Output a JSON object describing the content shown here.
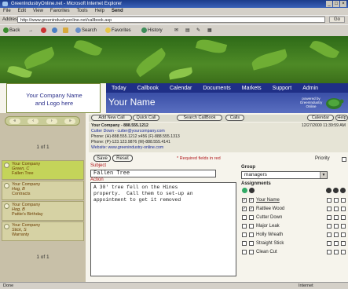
{
  "window": {
    "title": "GreenIndustryOnline.net - Microsoft Internet Explorer"
  },
  "menu": [
    "File",
    "Edit",
    "View",
    "Favorites",
    "Tools",
    "Help",
    "Send"
  ],
  "address": {
    "label": "Address",
    "url": "http://www.greenindustryonline.net/callbook.asp",
    "go": "Go"
  },
  "toolbar": {
    "back": "Back",
    "search": "Search",
    "favorites": "Favorites",
    "history": "History"
  },
  "site": {
    "logo_line1": "Your Company Name",
    "logo_line2": "and Logo here",
    "nav": [
      "Today",
      "Callbook",
      "Calendar",
      "Documents",
      "Markets",
      "Support",
      "Admin"
    ],
    "company_name": "Your Name",
    "powered_by": "powered by GreenIndustry Online"
  },
  "sidebar": {
    "page_top": "1 of 1",
    "page_bottom": "1 of 1",
    "contacts": [
      {
        "line1": "Your Company",
        "line2": "Green, C",
        "line3": "Fallen Tree",
        "selected": true
      },
      {
        "line1": "Your Company",
        "line2": "Hog, B",
        "line3": "Contracts",
        "selected": false
      },
      {
        "line1": "Your Company",
        "line2": "Hog, B",
        "line3": "Pattie's Birthday",
        "selected": false
      },
      {
        "line1": "Your Company",
        "line2": "Stick, S",
        "line3": "Warranty",
        "selected": false
      }
    ]
  },
  "actions": {
    "add_new_call": "Add New Call",
    "quick_call": "Quick Call",
    "search_callbook": "Search CallBook",
    "calls": "Calls",
    "calendar": "Calendar",
    "help": "Help"
  },
  "contact_info": {
    "company_line": "Your Company - 888.555.1212",
    "person_line": "Cutter Down - cutter@yourcompany.com",
    "phone1": "Phone: (H)-888.555.1212 x456  (F)-888.555.1313",
    "phone2": "Phone: (P)-123.123.9876  (M)-888.555.4141",
    "website": "Website: www.greenindustry-online.com",
    "timestamp": "12/27/2000 11:39:59 AM"
  },
  "form": {
    "save": "Save",
    "reset": "Reset",
    "required_note": "* Required fields in red",
    "priority_label": "Priority",
    "subject_label": "Subject",
    "subject_value": "Fallen Tree",
    "action_label": "Action",
    "action_value": "A 30' tree fell on the Hines\nproperty.  Call them to set-up an\nappointment to get it removed",
    "group_label": "Group",
    "group_value": "managers",
    "assignments_label": "Assignments",
    "assignees": [
      {
        "name": "Your Name",
        "checked": true
      },
      {
        "name": "Rattlee Wood",
        "checked": true
      },
      {
        "name": "Cutter Down",
        "checked": false
      },
      {
        "name": "Major Leak",
        "checked": false
      },
      {
        "name": "Holly Wreath",
        "checked": false
      },
      {
        "name": "Straight Stick",
        "checked": false
      },
      {
        "name": "Clean Cut",
        "checked": false
      }
    ]
  },
  "status": {
    "left": "Done",
    "zone": "Internet"
  }
}
